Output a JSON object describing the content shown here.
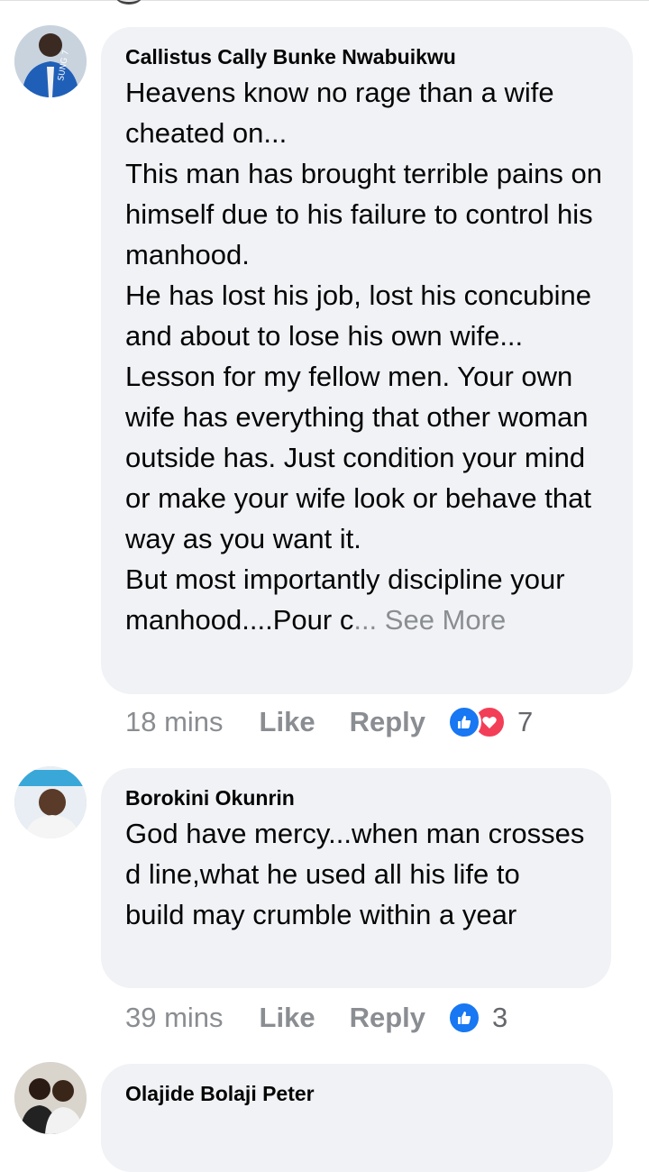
{
  "comments": [
    {
      "author": "Callistus Cally Bunke Nwabuikwu",
      "text": "Heavens know no rage than a wife cheated on...\nThis man has brought terrible pains on himself due to his failure to control his manhood.\nHe has lost his job, lost his concubine and about to lose his own wife...\nLesson for my fellow men. Your own wife has everything that other woman outside has. Just condition your mind or make your wife look or behave that way as you want it.\nBut most importantly discipline your manhood....Pour c",
      "see_more": "... See More",
      "time": "18 mins",
      "like_label": "Like",
      "reply_label": "Reply",
      "reaction_icons": [
        "like-icon",
        "love-icon"
      ],
      "reaction_count": "7"
    },
    {
      "author": "Borokini Okunrin",
      "text": "God have mercy...when man crosses d line,what he used all his life to build may crumble within a year",
      "time": "39 mins",
      "like_label": "Like",
      "reply_label": "Reply",
      "reaction_icons": [
        "like-icon"
      ],
      "reaction_count": "3"
    },
    {
      "author": "Olajide Bolaji Peter"
    }
  ],
  "colors": {
    "bubble": "#f0f2f5",
    "meta_text": "#8a8d91",
    "like_blue": "#1877f2",
    "love_red": "#f33e58"
  }
}
